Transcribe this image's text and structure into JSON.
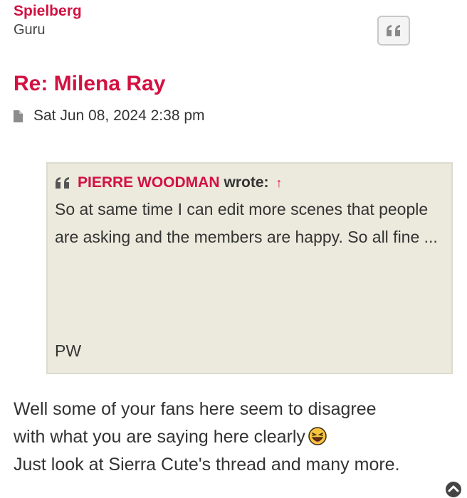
{
  "post": {
    "author": "Spielberg",
    "rank": "Guru",
    "title": "Re: Milena Ray",
    "date": "Sat Jun 08, 2024 2:38 pm",
    "quote": {
      "author": "PIERRE WOODMAN",
      "wrote_label": "wrote:",
      "arrow": "↑",
      "text": "So at same time I can edit more scenes that people are asking and the members are happy. So all fine ...",
      "signature": "PW"
    },
    "body": {
      "line1": "Well some of your fans here seem to disagree",
      "line2": "with what you are saying here clearly",
      "line3": "Just look at Sierra Cute's thread and many more."
    }
  },
  "icons": {
    "quote_button": "quote-icon",
    "post_meta": "file-icon",
    "cite": "quote-icon",
    "emoji": "laughing-face-emoji",
    "scroll_top": "chevron-up-circle-icon"
  },
  "colors": {
    "accent": "#d31141",
    "quote_bg": "#ebeadd",
    "quote_border": "#dbdbce"
  }
}
